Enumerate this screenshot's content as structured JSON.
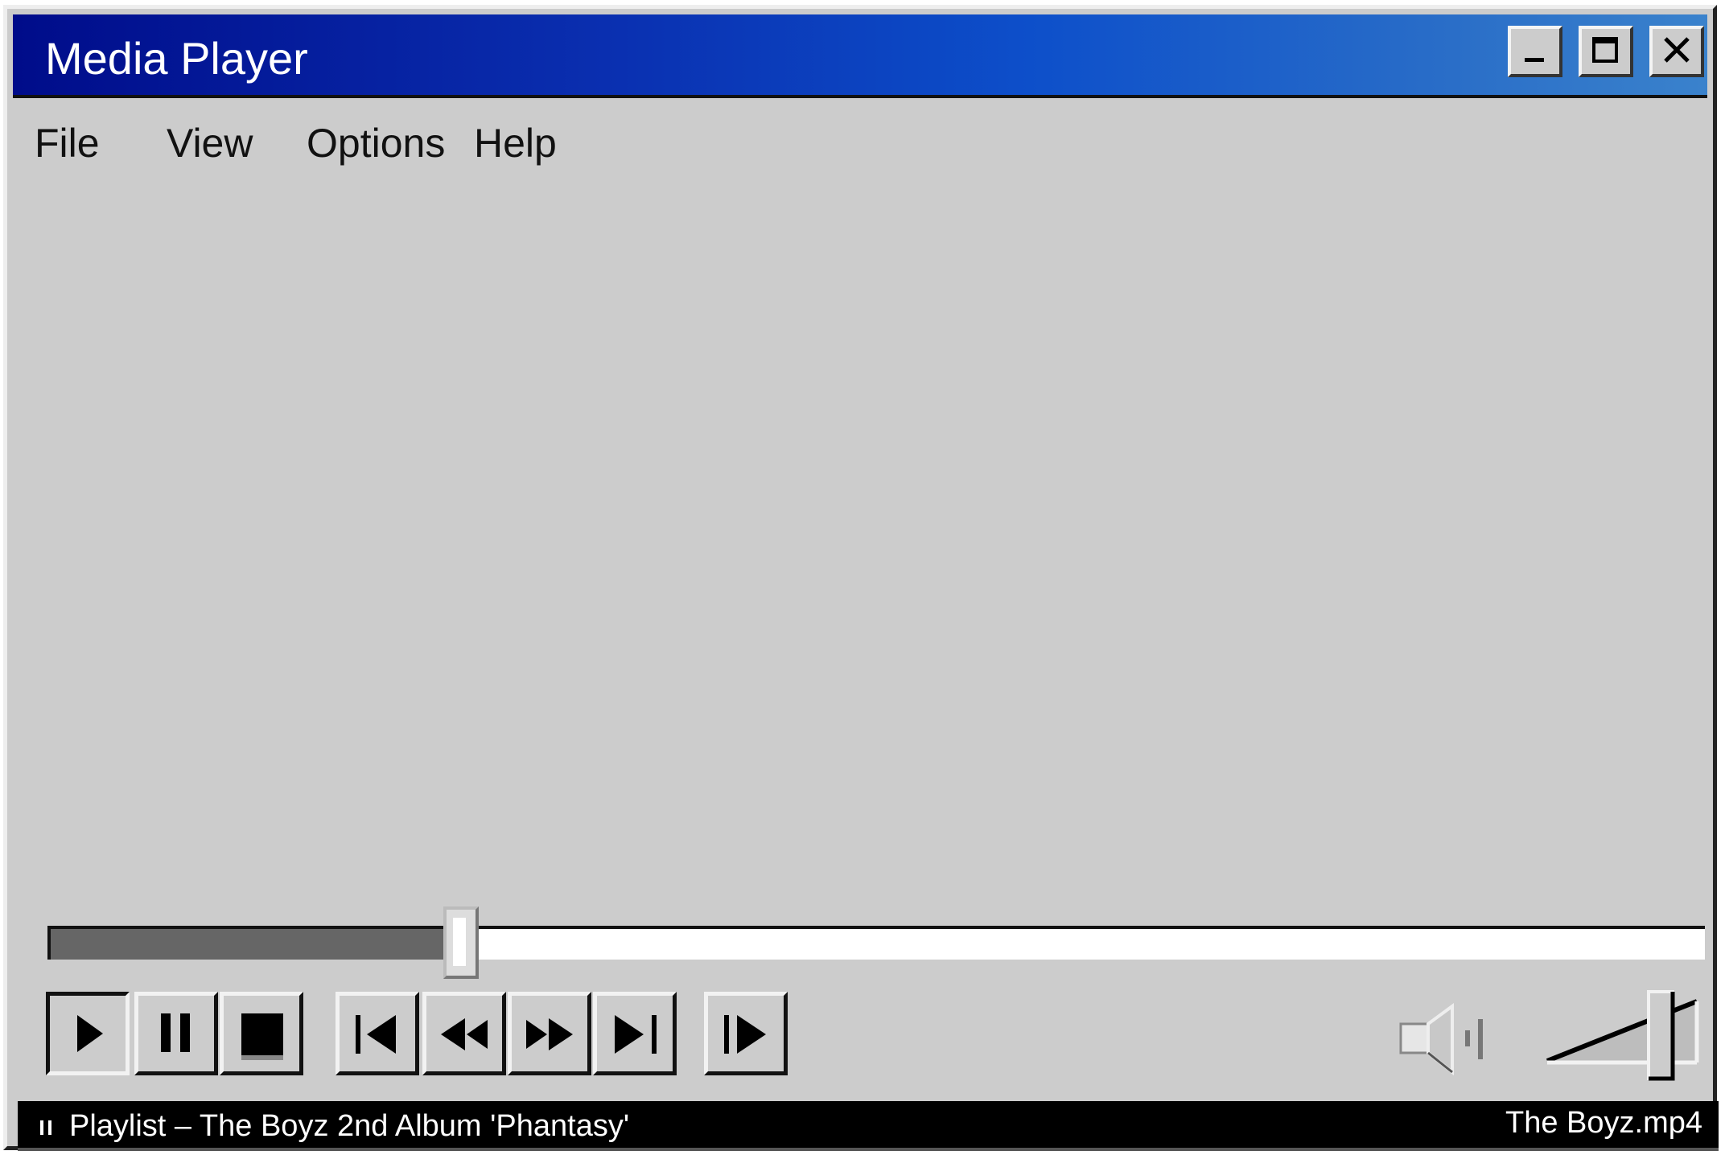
{
  "window": {
    "title": "Media Player",
    "controls": {
      "minimize_icon": "minimize-icon",
      "maximize_icon": "maximize-icon",
      "close_icon": "close-icon"
    }
  },
  "menu": {
    "items": [
      {
        "label": "File"
      },
      {
        "label": "View"
      },
      {
        "label": "Options"
      },
      {
        "label": "Help"
      }
    ]
  },
  "playback": {
    "progress_fraction": 0.24,
    "volume_fraction": 0.68,
    "buttons": [
      {
        "name": "play",
        "icon": "play-icon",
        "pressed": true
      },
      {
        "name": "pause",
        "icon": "pause-icon",
        "pressed": false
      },
      {
        "name": "stop",
        "icon": "stop-icon",
        "pressed": false
      },
      {
        "name": "previous",
        "icon": "skip-back-icon",
        "pressed": false
      },
      {
        "name": "rewind",
        "icon": "rewind-icon",
        "pressed": false
      },
      {
        "name": "fast-forward",
        "icon": "fast-forward-icon",
        "pressed": false
      },
      {
        "name": "next",
        "icon": "skip-forward-icon",
        "pressed": false
      },
      {
        "name": "step-forward",
        "icon": "step-forward-icon",
        "pressed": false
      }
    ]
  },
  "status": {
    "playlist_text": "Playlist – The Boyz 2nd Album 'Phantasy'",
    "file_name": "The Boyz.mp4",
    "state_icon": "pause-state-icon"
  },
  "colors": {
    "title_gradient_start": "#000c8a",
    "title_gradient_end": "#3a82cc",
    "window_face": "#cccccc",
    "status_bar": "#000000",
    "seek_fill": "#666666"
  }
}
